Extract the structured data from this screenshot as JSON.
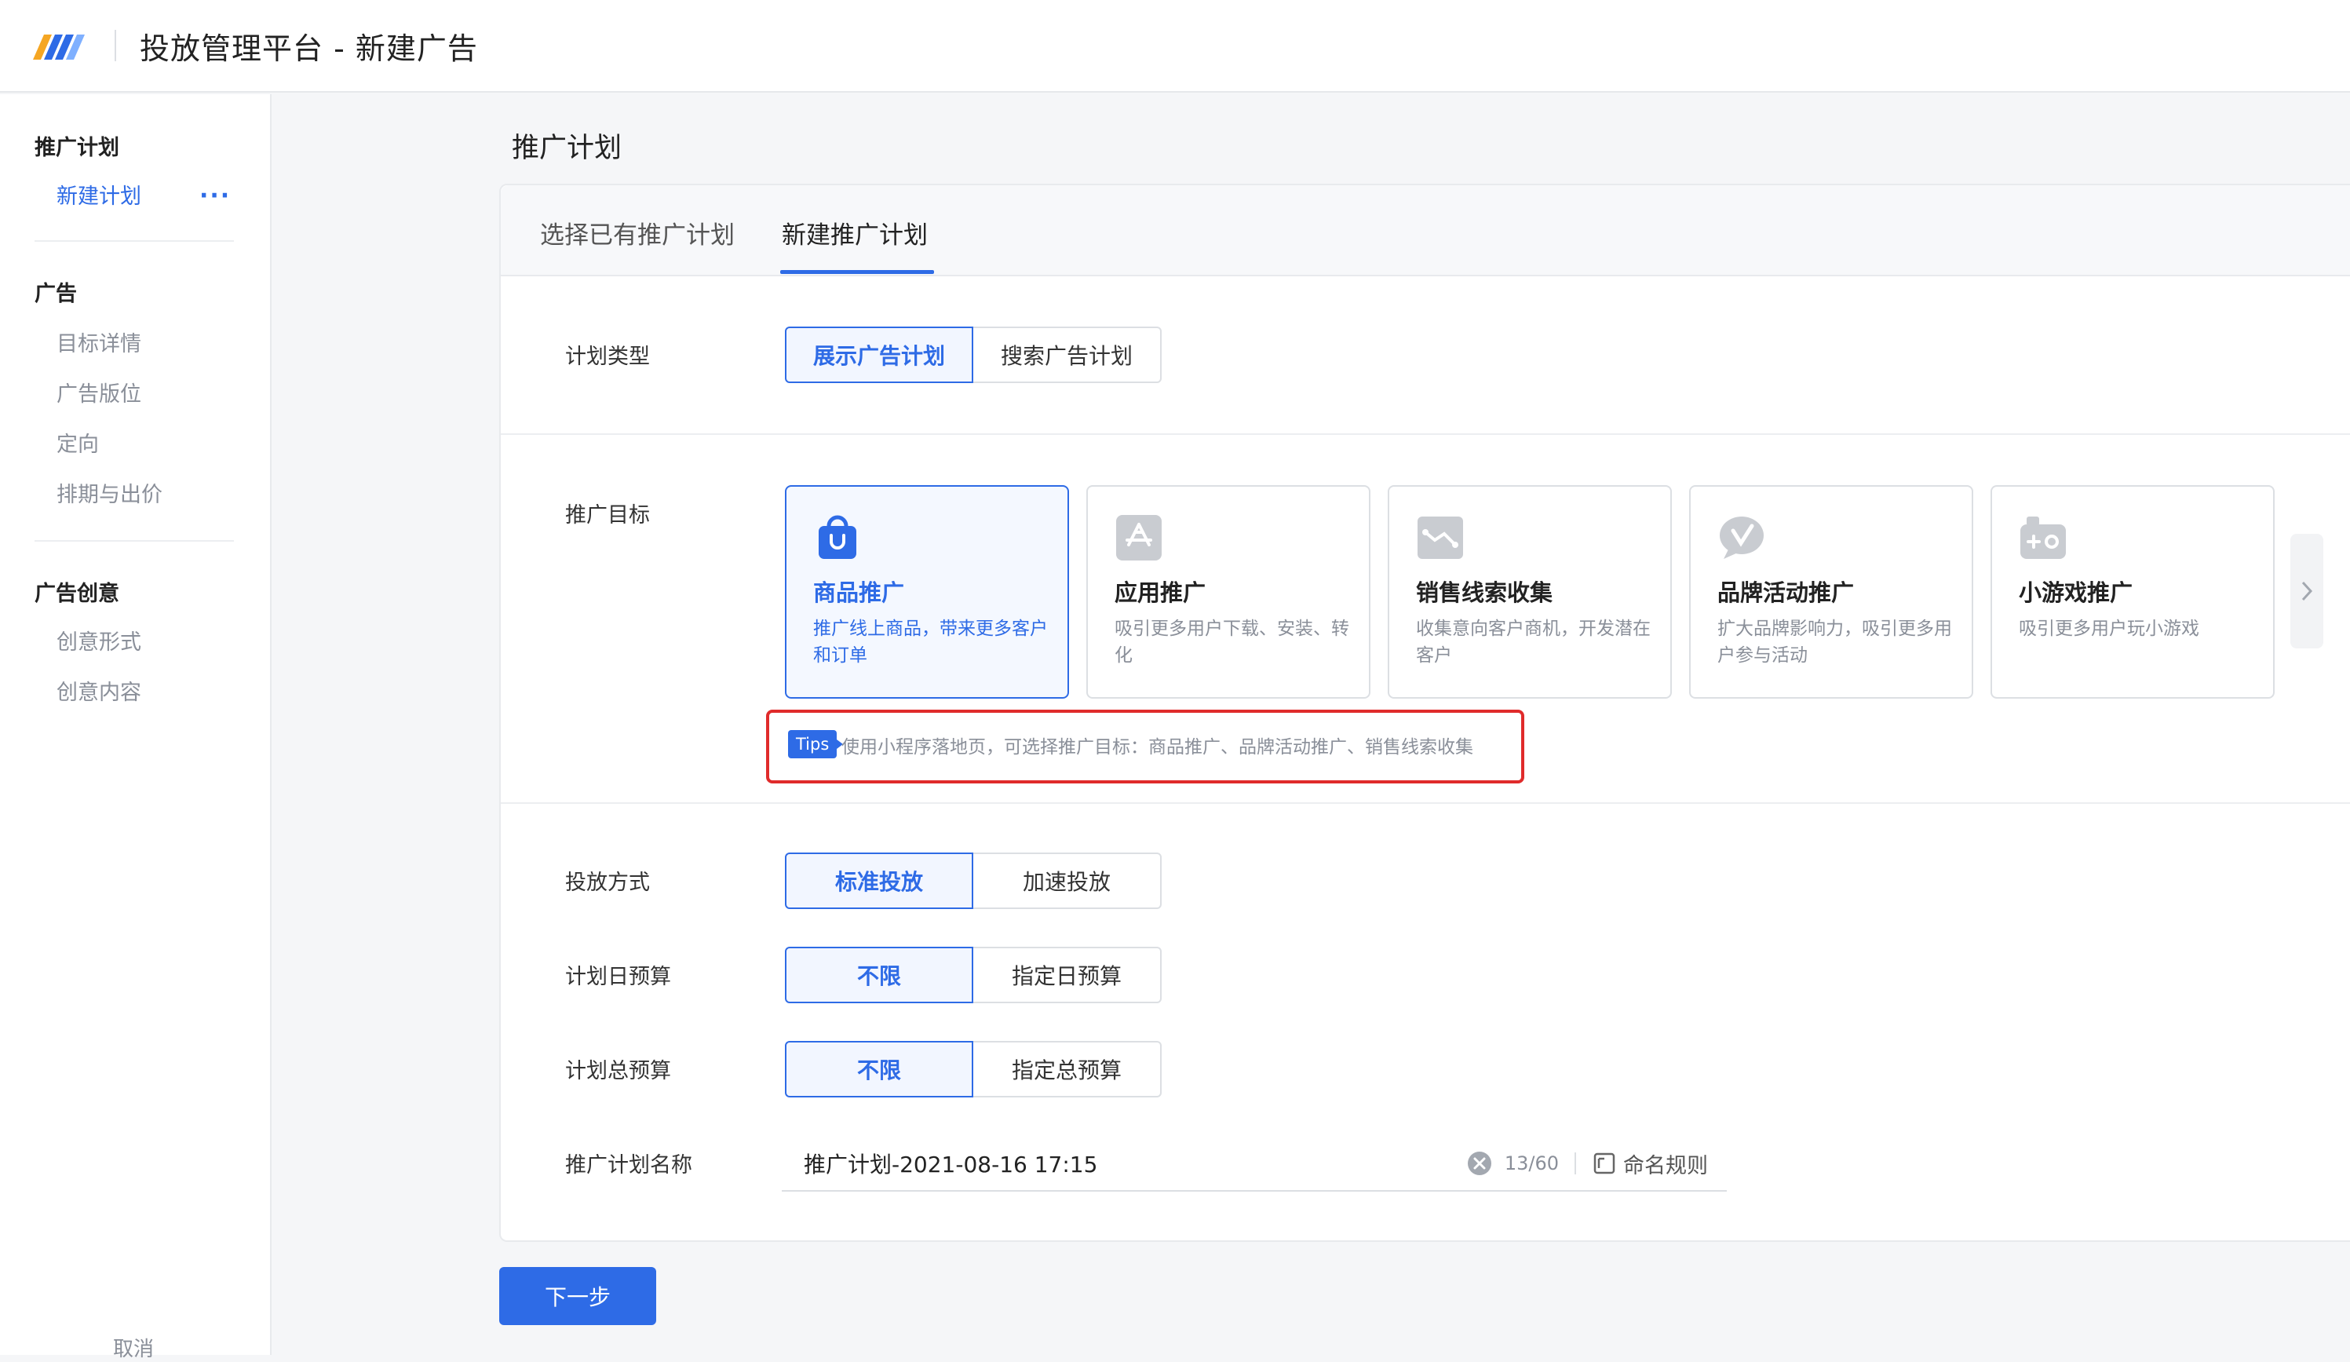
{
  "header": {
    "title": "投放管理平台 - 新建广告"
  },
  "sidebar": {
    "groups": [
      {
        "title": "推广计划",
        "items": [
          "新建计划"
        ]
      },
      {
        "title": "广告",
        "items": [
          "目标详情",
          "广告版位",
          "定向",
          "排期与出价"
        ]
      },
      {
        "title": "广告创意",
        "items": [
          "创意形式",
          "创意内容"
        ]
      }
    ],
    "more": "···",
    "cancel": "取消"
  },
  "main": {
    "page_title": "推广计划",
    "tabs": [
      "选择已有推广计划",
      "新建推广计划"
    ],
    "active_tab": "新建推广计划",
    "plan_type": {
      "label": "计划类型",
      "options": [
        "展示广告计划",
        "搜索广告计划"
      ],
      "selected": "展示广告计划"
    },
    "goal": {
      "label": "推广目标",
      "cards": [
        {
          "icon": "shopping-bag-icon",
          "title": "商品推广",
          "desc": "推广线上商品，带来更多客户和订单"
        },
        {
          "icon": "app-store-icon",
          "title": "应用推广",
          "desc": "吸引更多用户下载、安装、转化"
        },
        {
          "icon": "lead-chart-icon",
          "title": "销售线索收集",
          "desc": "收集意向客户商机，开发潜在客户"
        },
        {
          "icon": "brand-chat-icon",
          "title": "品牌活动推广",
          "desc": "扩大品牌影响力，吸引更多用户参与活动"
        },
        {
          "icon": "gamepad-icon",
          "title": "小游戏推广",
          "desc": "吸引更多用户玩小游戏"
        }
      ],
      "selected": "商品推广",
      "tips_badge": "Tips",
      "tips_text": "使用小程序落地页，可选择推广目标：商品推广、品牌活动推广、销售线索收集"
    },
    "delivery": {
      "label": "投放方式",
      "options": [
        "标准投放",
        "加速投放"
      ],
      "selected": "标准投放"
    },
    "daily_budget": {
      "label": "计划日预算",
      "options": [
        "不限",
        "指定日预算"
      ],
      "selected": "不限"
    },
    "total_budget": {
      "label": "计划总预算",
      "options": [
        "不限",
        "指定总预算"
      ],
      "selected": "不限"
    },
    "plan_name": {
      "label": "推广计划名称",
      "value": "推广计划-2021-08-16 17:15",
      "counter": "13/60",
      "rule_link": "命名规则"
    },
    "next_button": "下一步"
  },
  "colors": {
    "accent": "#2e6be6",
    "highlight_border": "#e02b2b"
  }
}
